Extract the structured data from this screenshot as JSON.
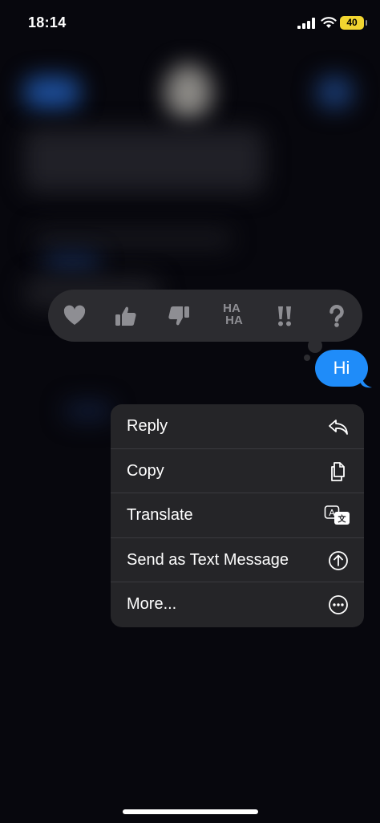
{
  "status_bar": {
    "time": "18:14",
    "battery": "40"
  },
  "reactions": [
    {
      "icon": "heart-icon"
    },
    {
      "icon": "thumbs-up-icon"
    },
    {
      "icon": "thumbs-down-icon"
    },
    {
      "icon": "haha-icon"
    },
    {
      "icon": "exclamation-icon"
    },
    {
      "icon": "question-icon"
    }
  ],
  "haha_top": "HA",
  "haha_bottom": "HA",
  "message": {
    "text": "Hi"
  },
  "menu": {
    "items": [
      {
        "label": "Reply",
        "icon": "reply-icon"
      },
      {
        "label": "Copy",
        "icon": "copy-icon"
      },
      {
        "label": "Translate",
        "icon": "translate-icon"
      },
      {
        "label": "Send as Text Message",
        "icon": "arrow-up-circle-icon"
      },
      {
        "label": "More...",
        "icon": "ellipsis-circle-icon"
      }
    ]
  },
  "colors": {
    "bubble": "#1f8cf9",
    "menu_bg": "#252528",
    "battery": "#f2d530"
  }
}
